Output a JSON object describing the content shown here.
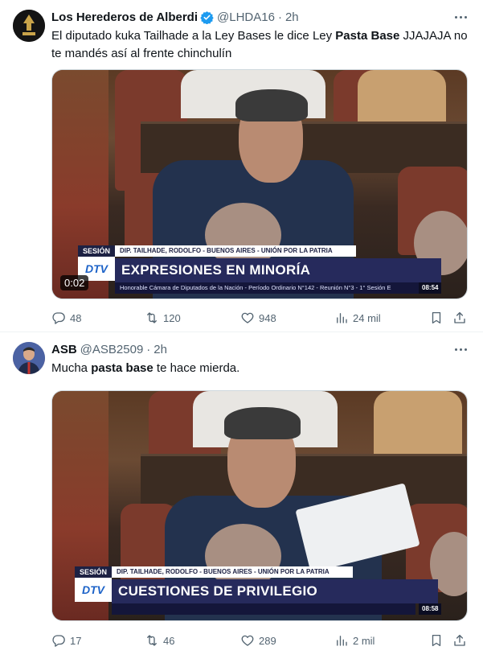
{
  "tweets": [
    {
      "author": {
        "name": "Los Herederos de Alberdi",
        "handle": "@LHDA16",
        "time": "2h",
        "verified": true
      },
      "text_parts": [
        "El diputado kuka Tailhade a la Ley Bases le dice Ley ",
        "Pasta Base",
        " JJAJAJA no te mandés así al frente chinchulín"
      ],
      "media": {
        "session_tag": "SESIÓN",
        "name_strip": "DIP. TAILHADE, RODOLFO - BUENOS AIRES - UNIÓN POR LA PATRIA",
        "logo": "DTV",
        "headline": "EXPRESIONES EN MINORÍA",
        "ticker": "Honorable Cámara de Diputados de la Nación - Período Ordinario N°142 - Reunión N°3 - 1° Sesión E",
        "clock": "08:54",
        "duration": "0:02"
      },
      "stats": {
        "replies": "48",
        "retweets": "120",
        "likes": "948",
        "views": "24 mil"
      }
    },
    {
      "author": {
        "name": "ASB",
        "handle": "@ASB2509",
        "time": "2h",
        "verified": false
      },
      "text_parts": [
        "Mucha ",
        "pasta base",
        " te hace mierda."
      ],
      "media": {
        "session_tag": "SESIÓN",
        "name_strip": "DIP. TAILHADE, RODOLFO - BUENOS AIRES - UNIÓN POR LA PATRIA",
        "logo": "DTV",
        "headline": "CUESTIONES DE PRIVILEGIO",
        "clock": "08:58"
      },
      "stats": {
        "replies": "17",
        "retweets": "46",
        "likes": "289",
        "views": "2 mil"
      }
    }
  ],
  "icons": [
    "more-icon",
    "verified-icon",
    "reply-icon",
    "retweet-icon",
    "like-icon",
    "views-icon",
    "bookmark-icon",
    "share-icon"
  ],
  "colors": {
    "text": "#0f1419",
    "secondary": "#536471",
    "verified": "#1d9bf0",
    "divider": "#eff3f4",
    "tv_banner": "#262a5c"
  }
}
